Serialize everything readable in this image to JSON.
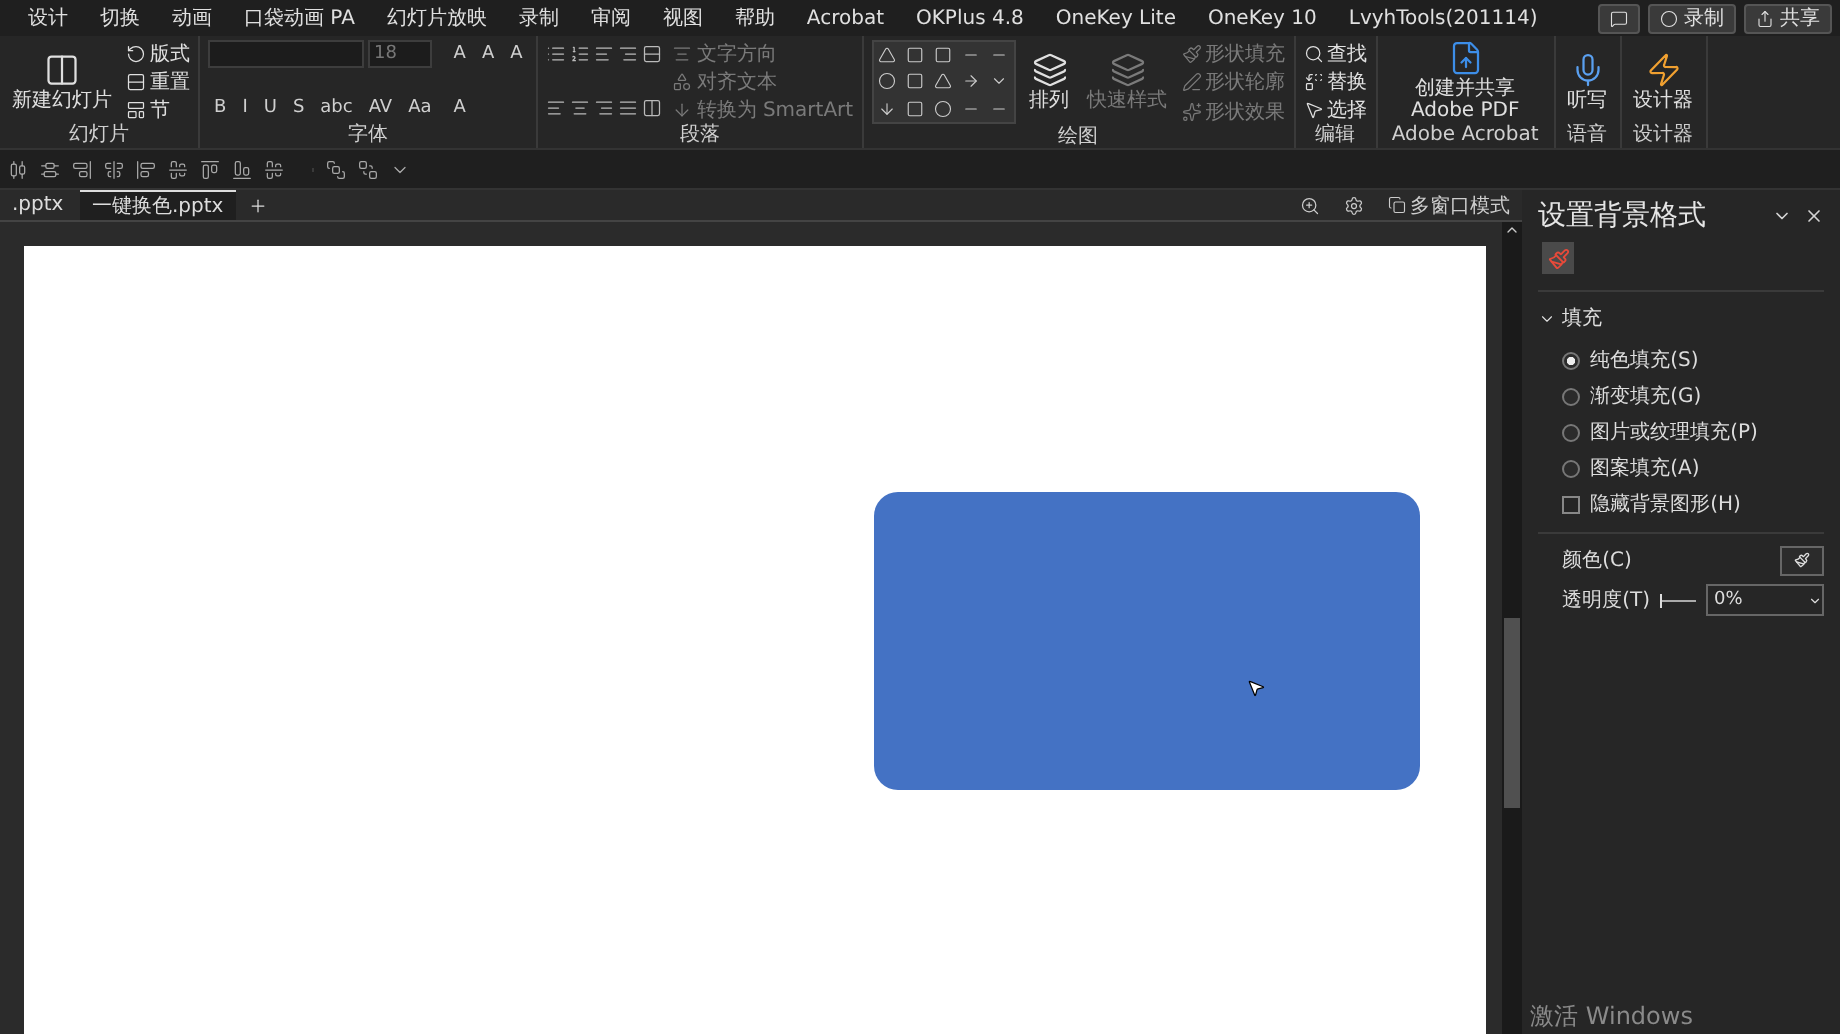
{
  "menu_tabs": [
    "设计",
    "切换",
    "动画",
    "口袋动画 PA",
    "幻灯片放映",
    "录制",
    "审阅",
    "视图",
    "帮助",
    "Acrobat",
    "OKPlus 4.8",
    "OneKey Lite",
    "OneKey 10",
    "LvyhTools(201114)"
  ],
  "top_actions": [
    {
      "label": "录制"
    },
    {
      "label": "共享"
    }
  ],
  "ribbon": [
    {
      "label": "幻灯片",
      "columns": [
        [
          {
            "kind": "large",
            "label": "新建幻灯片",
            "disabled": false
          }
        ],
        [
          {
            "kind": "small",
            "label": "版式",
            "disabled": false
          },
          {
            "kind": "small",
            "label": "重置",
            "disabled": false
          },
          {
            "kind": "small",
            "label": "节",
            "disabled": false
          }
        ]
      ]
    },
    {
      "label": "字体",
      "columns": [
        [
          {
            "kind": "fields",
            "value": "18"
          },
          {
            "kind": "tools",
            "labels": [
              "B",
              "I",
              "U",
              "S",
              "abc",
              "AV",
              "Aa"
            ]
          }
        ],
        [
          {
            "kind": "tools",
            "labels": [
              "A",
              "A",
              "A"
            ]
          },
          {
            "kind": "tools",
            "labels": [
              "A"
            ]
          }
        ]
      ]
    },
    {
      "label": "段落",
      "columns": [
        [
          {
            "kind": "list-icons"
          },
          {
            "kind": "align-icons"
          }
        ],
        [
          {
            "kind": "small",
            "label": "文字方向",
            "disabled": true
          },
          {
            "kind": "small",
            "label": "对齐文本",
            "disabled": true
          },
          {
            "kind": "small",
            "label": "转换为 SmartArt",
            "disabled": true
          }
        ]
      ]
    },
    {
      "label": "绘图",
      "columns": [
        [
          {
            "kind": "shape-gallery"
          }
        ],
        [
          {
            "kind": "large",
            "label": "排列",
            "disabled": false
          }
        ],
        [
          {
            "kind": "large",
            "label": "快速样式",
            "disabled": true
          }
        ],
        [
          {
            "kind": "small",
            "label": "形状填充",
            "disabled": true
          },
          {
            "kind": "small",
            "label": "形状轮廓",
            "disabled": true
          },
          {
            "kind": "small",
            "label": "形状效果",
            "disabled": true
          }
        ]
      ]
    },
    {
      "label": "编辑",
      "columns": [
        [
          {
            "kind": "small",
            "label": "查找",
            "disabled": false
          },
          {
            "kind": "small",
            "label": "替换",
            "disabled": false
          },
          {
            "kind": "small",
            "label": "选择",
            "disabled": false
          }
        ]
      ]
    },
    {
      "label": "Adobe Acrobat",
      "columns": [
        [
          {
            "kind": "large",
            "label": "创建并共享 Adobe PDF",
            "disabled": false
          }
        ]
      ]
    },
    {
      "label": "语音",
      "columns": [
        [
          {
            "kind": "large",
            "label": "听写",
            "disabled": false
          }
        ]
      ]
    },
    {
      "label": "设计器",
      "columns": [
        [
          {
            "kind": "large",
            "label": "设计器",
            "disabled": false
          }
        ]
      ]
    }
  ],
  "doc_tabs": [
    {
      "label": ".pptx",
      "selected": false
    },
    {
      "label": "一键换色.pptx",
      "selected": true
    }
  ],
  "view_toggle": "多窗口模式",
  "slide": {
    "shapes": [
      {
        "kind": "rounded-rectangle",
        "color": "#4472c4"
      }
    ]
  },
  "pane": {
    "title": "设置背景格式",
    "section": {
      "label": "填充",
      "expanded": true
    },
    "options": [
      {
        "label": "纯色填充(S)",
        "selected": true
      },
      {
        "label": "渐变填充(G)",
        "selected": false
      },
      {
        "label": "图片或纹理填充(P)",
        "selected": false
      },
      {
        "label": "图案填充(A)",
        "selected": false
      }
    ],
    "hide_graphics": {
      "label": "隐藏背景图形(H)",
      "checked": false
    },
    "color_label": "颜色(C)",
    "transparency": {
      "label": "透明度(T)",
      "level": 0,
      "value": "0%"
    }
  },
  "activation": "激活 Windows"
}
